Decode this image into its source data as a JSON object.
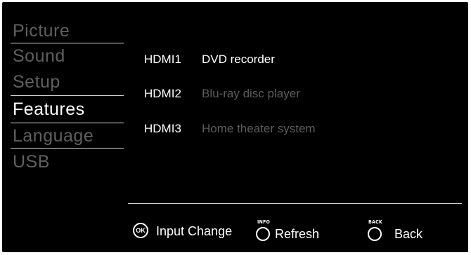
{
  "menu": {
    "items": [
      {
        "label": "Picture",
        "active": false
      },
      {
        "label": "Sound",
        "active": false
      },
      {
        "label": "Setup",
        "active": false
      },
      {
        "label": "Features",
        "active": true
      },
      {
        "label": "Language",
        "active": false
      },
      {
        "label": "USB",
        "active": false
      }
    ]
  },
  "hdmi_list": [
    {
      "port": "HDMI1",
      "device": "DVD recorder",
      "selected": true
    },
    {
      "port": "HDMI2",
      "device": "Blu-ray disc player",
      "selected": false
    },
    {
      "port": "HDMI3",
      "device": "Home theater system",
      "selected": false
    }
  ],
  "footer": {
    "input_change": {
      "key": "OK",
      "label": "Input Change",
      "icon": "ok-button-icon"
    },
    "refresh": {
      "key": "INFO",
      "label": "Refresh",
      "icon": "info-button-icon"
    },
    "back": {
      "key": "BACK",
      "label": "Back",
      "icon": "back-button-icon"
    }
  },
  "colors": {
    "background": "#000000",
    "active_text": "#ffffff",
    "inactive_text": "#5f5f5f",
    "divider": "#d8d8d8"
  }
}
